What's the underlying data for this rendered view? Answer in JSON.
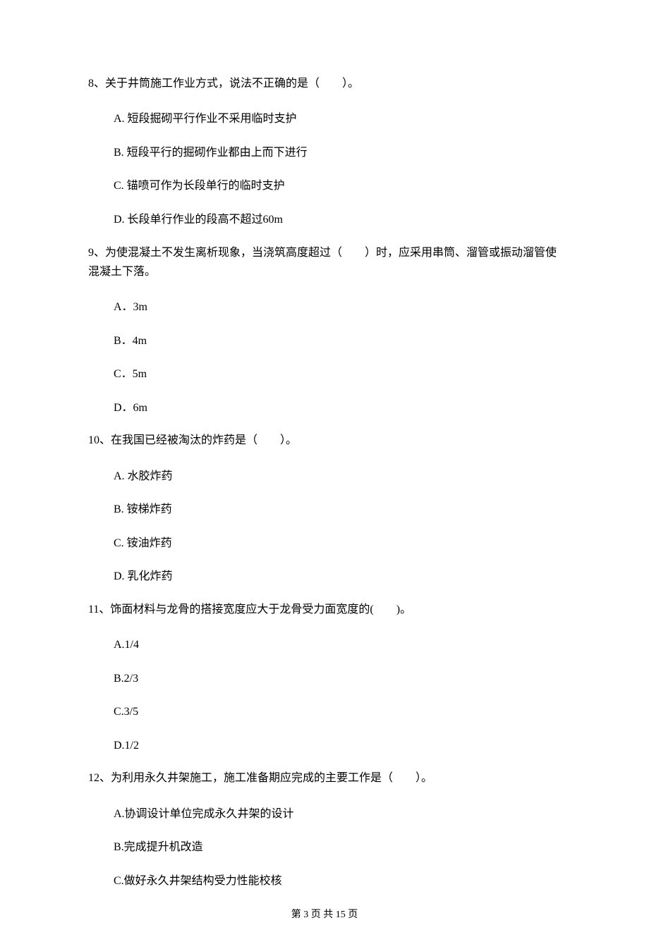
{
  "questions": [
    {
      "id": "q8",
      "stem": "8、关于井筒施工作业方式，说法不正确的是（　　）。",
      "options": [
        "A.  短段掘砌平行作业不采用临时支护",
        "B.  短段平行的掘砌作业都由上而下进行",
        "C.  锚喷可作为长段单行的临时支护",
        "D.  长段单行作业的段高不超过60m"
      ]
    },
    {
      "id": "q9",
      "stem": "9、为使混凝土不发生离析现象，当浇筑高度超过（　　）时，应采用串筒、溜管或振动溜管使混凝土下落。",
      "options": [
        "A．3m",
        "B．4m",
        "C．5m",
        "D．6m"
      ]
    },
    {
      "id": "q10",
      "stem": "10、在我国已经被淘汰的炸药是（　　）。",
      "options": [
        "A.  水胶炸药",
        "B.  铵梯炸药",
        "C.  铵油炸药",
        "D.  乳化炸药"
      ]
    },
    {
      "id": "q11",
      "stem": "11、饰面材料与龙骨的搭接宽度应大于龙骨受力面宽度的(　　)。",
      "options": [
        "A.1/4",
        "B.2/3",
        "C.3/5",
        "D.1/2"
      ]
    },
    {
      "id": "q12",
      "stem": "12、为利用永久井架施工，施工准备期应完成的主要工作是（　　）。",
      "options": [
        "A.协调设计单位完成永久井架的设计",
        "B.完成提升机改造",
        "C.做好永久井架结构受力性能校核"
      ]
    }
  ],
  "footer": "第 3 页 共 15 页"
}
